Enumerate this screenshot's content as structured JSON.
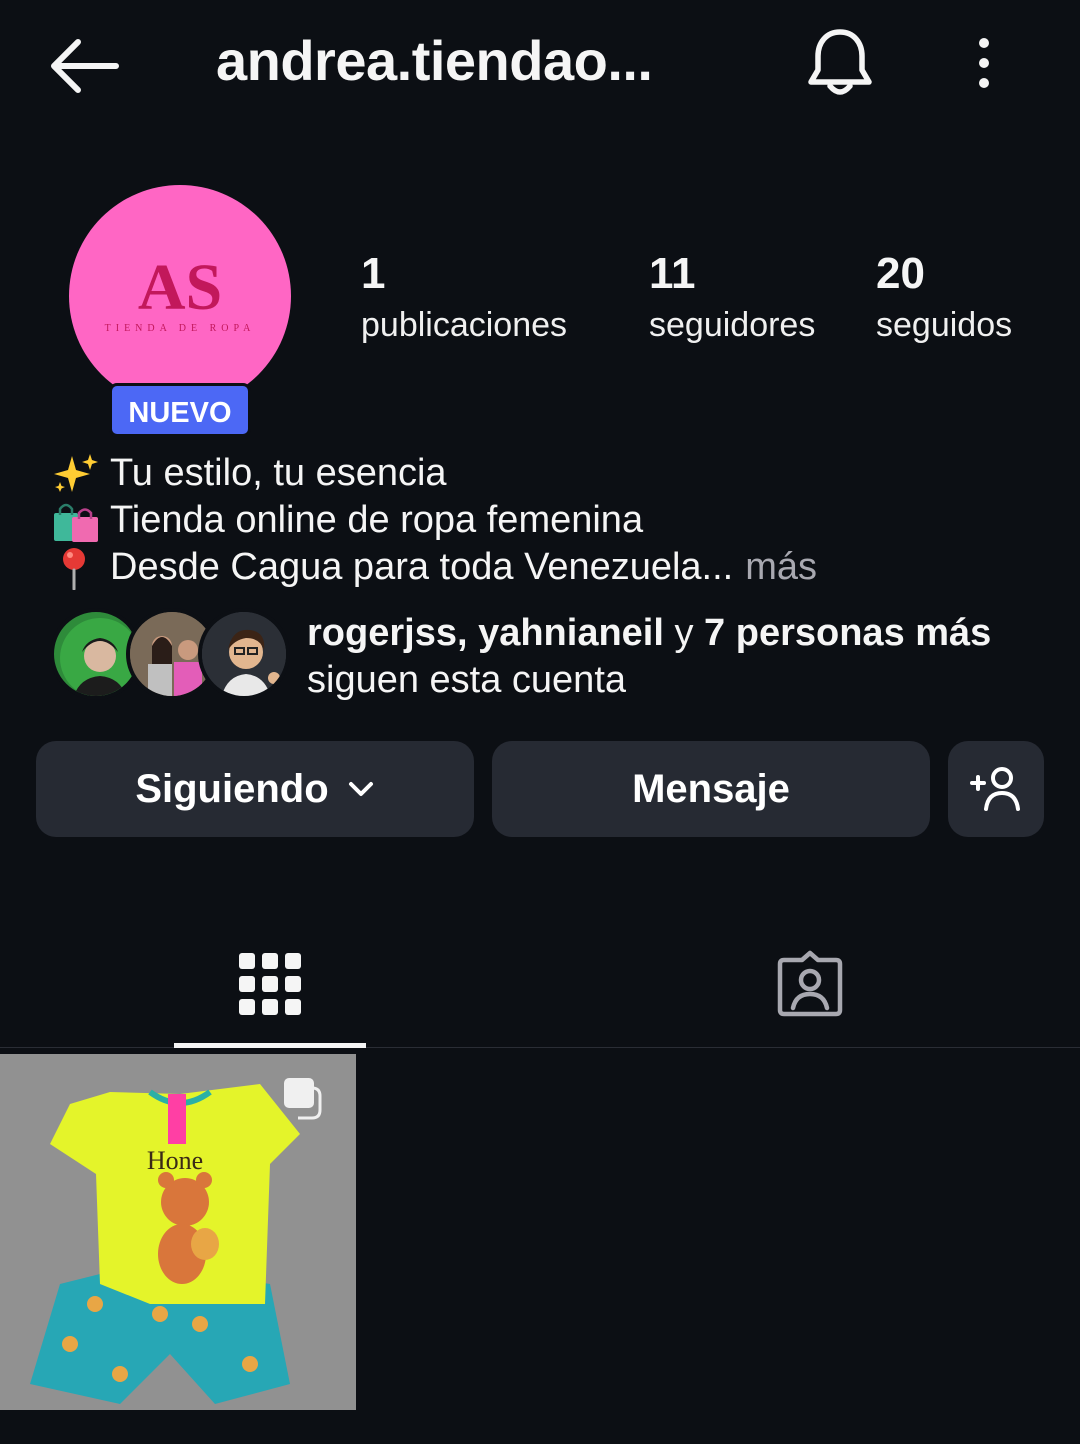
{
  "header": {
    "title": "andrea.tiendao...",
    "back_icon": "back-arrow-icon",
    "bell_icon": "bell-icon",
    "more_icon": "more-vertical-icon"
  },
  "profile": {
    "avatar_text": "AS",
    "avatar_subtext": "TIENDA DE ROPA",
    "badge": "NUEVO",
    "accent": "#ff66c4",
    "badge_color": "#4c68f5"
  },
  "stats": [
    {
      "value": "1",
      "label": "publicaciones"
    },
    {
      "value": "11",
      "label": "seguidores"
    },
    {
      "value": "20",
      "label": "seguidos"
    }
  ],
  "bio": {
    "lines": [
      {
        "emoji": "sparkles-icon",
        "text": " Tu estilo, tu esencia"
      },
      {
        "emoji": "shopping-bags-icon",
        "text": "Tienda online de ropa femenina"
      },
      {
        "emoji": "pin-icon",
        "text": "Desde Cagua para toda Venezuela..."
      }
    ],
    "more": "más"
  },
  "followed_by": {
    "names": "rogerjss, yahnianeil",
    "conj": " y ",
    "others": "7 personas más",
    "suffix": "siguen esta cuenta"
  },
  "actions": {
    "following": "Siguiendo",
    "message": "Mensaje",
    "add_icon": "add-person-icon"
  },
  "tabs": {
    "grid_icon": "grid-icon",
    "tagged_icon": "tagged-person-icon"
  }
}
